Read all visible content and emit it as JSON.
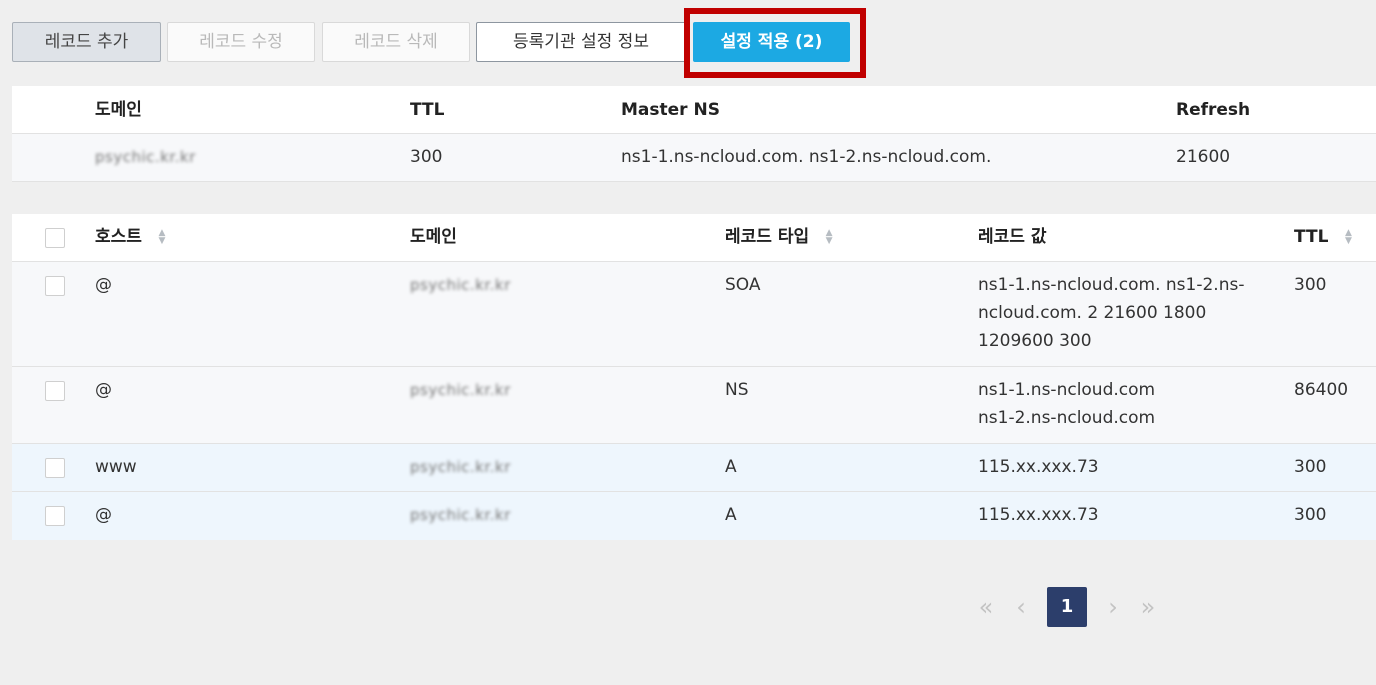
{
  "toolbar": {
    "add_record": "레코드 추가",
    "edit_record": "레코드 수정",
    "delete_record": "레코드 삭제",
    "registrar_info": "등록기관 설정 정보",
    "apply_settings": "설정 적용 (2)"
  },
  "zone": {
    "headers": {
      "domain": "도메인",
      "ttl": "TTL",
      "master_ns": "Master NS",
      "refresh": "Refresh"
    },
    "row": {
      "domain": "psychic.kr.kr",
      "ttl": "300",
      "master_ns": "ns1-1.ns-ncloud.com. ns1-2.ns-ncloud.com.",
      "refresh": "21600"
    }
  },
  "records": {
    "headers": {
      "host": "호스트",
      "domain": "도메인",
      "type": "레코드 타입",
      "value": "레코드 값",
      "ttl": "TTL"
    },
    "rows": [
      {
        "host": "@",
        "domain": "psychic.kr.kr",
        "type": "SOA",
        "value_lines": [
          "ns1-1.ns-ncloud.com. ns1-2.ns-",
          "ncloud.com. 2 21600 1800",
          "1209600 300"
        ],
        "ttl": "300"
      },
      {
        "host": "@",
        "domain": "psychic.kr.kr",
        "type": "NS",
        "value_lines": [
          "ns1-1.ns-ncloud.com",
          "ns1-2.ns-ncloud.com"
        ],
        "ttl": "86400"
      },
      {
        "host": "www",
        "domain": "psychic.kr.kr",
        "type": "A",
        "value_lines": [
          "115.xx.xxx.73"
        ],
        "ttl": "300"
      },
      {
        "host": "@",
        "domain": "psychic.kr.kr",
        "type": "A",
        "value_lines": [
          "115.xx.xxx.73"
        ],
        "ttl": "300"
      }
    ]
  },
  "pagination": {
    "first": "«",
    "prev": "‹",
    "current": "1",
    "next": "›",
    "last": "»"
  },
  "icons": {
    "sort": "sort-arrows-icon",
    "first": "double-chevron-left-icon",
    "prev": "chevron-left-icon",
    "next": "chevron-right-icon",
    "last": "double-chevron-right-icon"
  },
  "colors": {
    "primary": "#1ca9e3",
    "highlight": "#c00000",
    "pager_active": "#2c3e6b"
  }
}
